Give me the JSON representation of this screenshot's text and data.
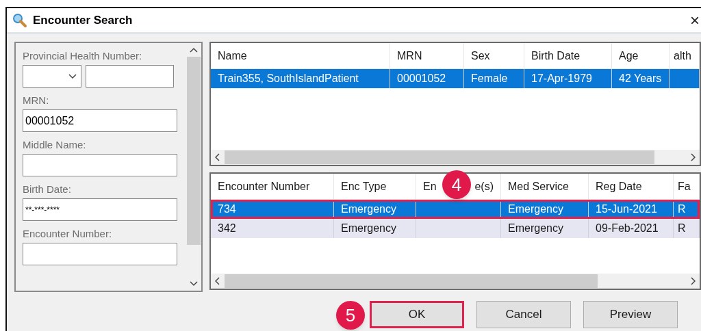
{
  "window": {
    "title": "Encounter Search",
    "close": "×"
  },
  "search_form": {
    "fields": [
      {
        "kind": "combo",
        "label": "Provincial Health Number:"
      },
      {
        "kind": "text",
        "label": "MRN:",
        "value": "00001052"
      },
      {
        "kind": "text",
        "label": "Middle Name:"
      },
      {
        "kind": "text",
        "label": "Birth Date:",
        "value": "**-***-****"
      },
      {
        "kind": "text",
        "label": "Encounter Number:"
      }
    ]
  },
  "patients_table": {
    "columns": [
      {
        "label": "Name"
      },
      {
        "label": "MRN"
      },
      {
        "label": "Sex"
      },
      {
        "label": "Birth Date"
      },
      {
        "label": "Age"
      },
      {
        "label": "alth"
      }
    ],
    "rows": [
      {
        "selected": true,
        "highlighted": false,
        "cells": [
          "Train355, SouthIslandPatient",
          "00001052",
          "Female",
          "17-Apr-1979",
          "42 Years",
          ""
        ]
      }
    ]
  },
  "encounters_table": {
    "columns": [
      {
        "label": "Encounter Number"
      },
      {
        "label": "Enc Type"
      },
      {
        "label_parts": [
          "En",
          "e(s)"
        ]
      },
      {
        "label": "Med Service"
      },
      {
        "label": "Reg Date"
      },
      {
        "label": "Fa"
      }
    ],
    "rows": [
      {
        "selected": true,
        "highlighted": true,
        "cells": [
          "734",
          "Emergency",
          "",
          "Emergency",
          "15-Jun-2021",
          "R"
        ]
      },
      {
        "selected": false,
        "highlighted": false,
        "cells": [
          "342",
          "Emergency",
          "",
          "Emergency",
          "09-Feb-2021",
          "R"
        ]
      }
    ]
  },
  "buttons": [
    {
      "label": "OK",
      "highlighted": true
    },
    {
      "label": "Cancel",
      "highlighted": false
    },
    {
      "label": "Preview",
      "highlighted": false
    }
  ],
  "annotations": [
    {
      "number": "4"
    },
    {
      "number": "5"
    }
  ]
}
